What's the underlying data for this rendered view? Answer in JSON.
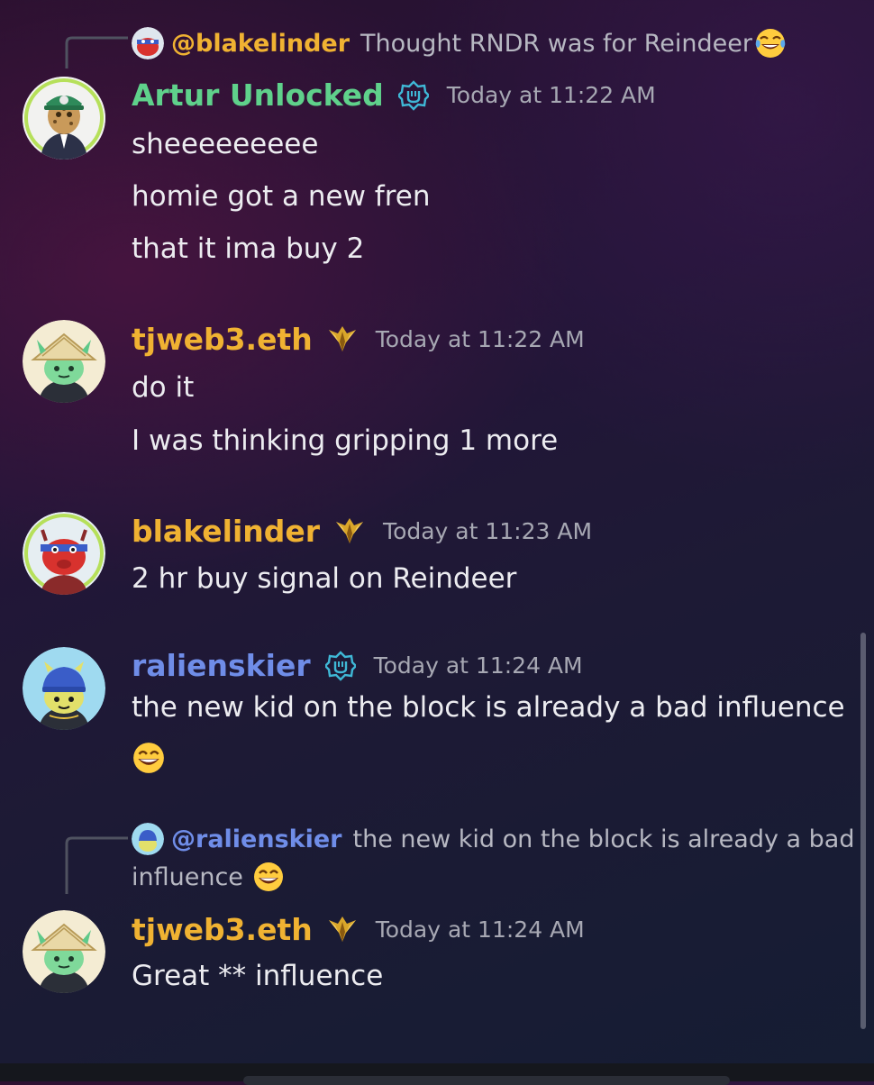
{
  "colors": {
    "gold": "#f0b232",
    "green": "#5fd18b",
    "blue": "#6f8de8",
    "timestamp": "#a7a8b3",
    "text": "#ececf0"
  },
  "messages": [
    {
      "reply": {
        "mention": "@blakelinder",
        "text": "Thought RNDR was for Reindeer",
        "emoji": "joy-emoji"
      },
      "author": "Artur Unlocked",
      "author_color": "green",
      "badge_icon": "verified-badge-icon",
      "time": "Today at 11:22 AM",
      "lines": [
        "sheeeeeeeee",
        "homie got a new fren",
        "that it ima buy 2"
      ]
    },
    {
      "author": "tjweb3.eth",
      "author_color": "gold",
      "badge_icon": "gold-wings-icon",
      "time": "Today at 11:22 AM",
      "lines": [
        "do it",
        "I was thinking gripping 1 more"
      ]
    },
    {
      "author": "blakelinder",
      "author_color": "gold",
      "badge_icon": "gold-wings-icon",
      "time": "Today at 11:23 AM",
      "lines": [
        "2 hr buy signal on Reindeer"
      ]
    },
    {
      "author": "ralienskier",
      "author_color": "blue",
      "badge_icon": "verified-badge-icon",
      "time": "Today at 11:24 AM",
      "lines": [
        "the new kid on the block is already a bad influence"
      ],
      "trailing_emoji": "grin-emoji"
    },
    {
      "reply": {
        "mention": "@ralienskier",
        "text": "the new kid on the block is already a bad",
        "text_line2": "influence",
        "emoji": "grin-emoji"
      },
      "author": "tjweb3.eth",
      "author_color": "gold",
      "badge_icon": "gold-wings-icon",
      "time": "Today at 11:24 AM",
      "lines": [
        "Great ** influence"
      ]
    }
  ]
}
